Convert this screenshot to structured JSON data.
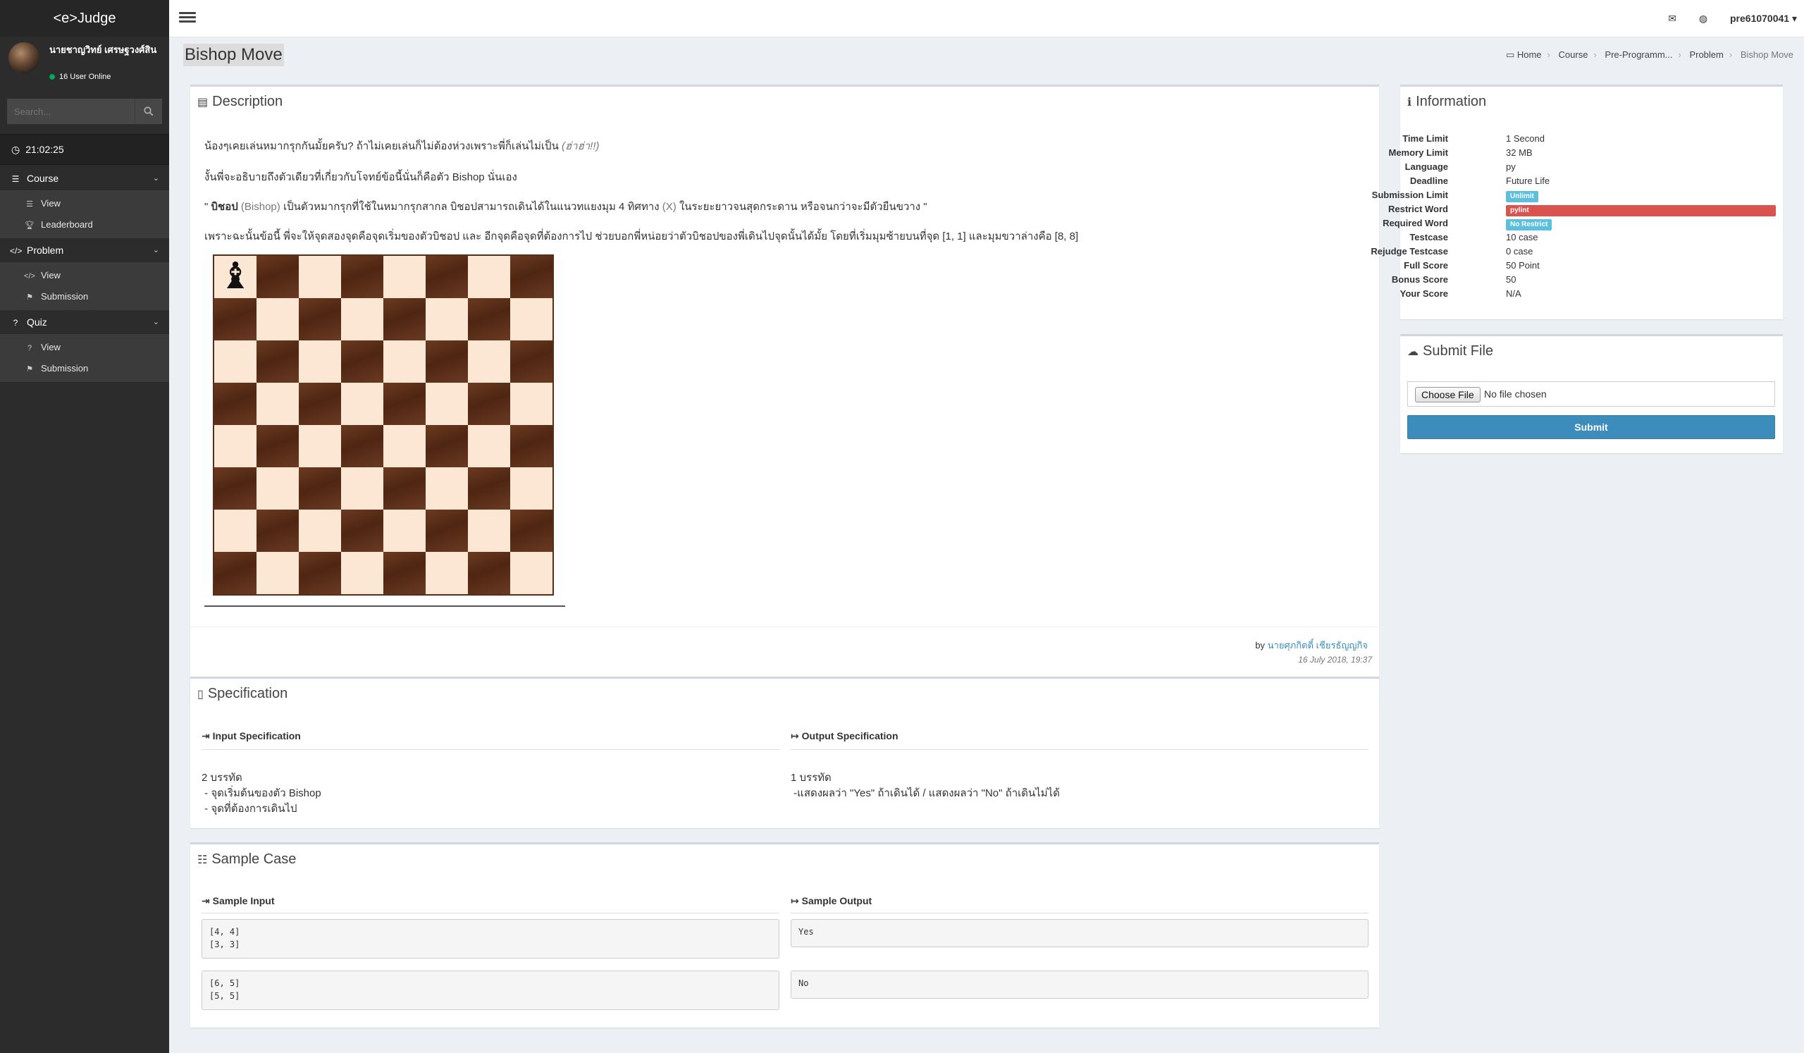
{
  "app": {
    "logo": "<e>Judge"
  },
  "user": {
    "name": "นายชาญวิทย์ เศรษฐวงศ์สิน",
    "online": "16 User Online"
  },
  "search": {
    "placeholder": "Search..."
  },
  "clock": {
    "time": "21:02:25"
  },
  "sidebar": {
    "course": {
      "label": "Course",
      "items": [
        "View",
        "Leaderboard"
      ]
    },
    "problem": {
      "label": "Problem",
      "items": [
        "View",
        "Submission"
      ]
    },
    "quiz": {
      "label": "Quiz",
      "items": [
        "View",
        "Submission"
      ]
    }
  },
  "navbar": {
    "username": "pre61070041"
  },
  "page": {
    "title": "Bishop Move"
  },
  "breadcrumb": [
    "Home",
    "Course",
    "Pre-Programm...",
    "Problem",
    "Bishop Move"
  ],
  "description": {
    "title": "Description",
    "p1": "น้องๆเคยเล่นหมากรุกกันมั้ยครับ? ถ้าไม่เคยเล่นก็ไม่ต้องห่วงเพราะพี่ก็เล่นไม่เป็น",
    "p1_note": "(ฮ่าฮ่า!!)",
    "p2": "งั้นพี่จะอธิบายถึงตัวเดียวที่เกี่ยวกับโจทย์ข้อนี้นั่นก็คือตัว Bishop นั่นเอง",
    "p3_open": "\"",
    "p3_bold": "บิชอป",
    "p3_paren": "(Bishop)",
    "p3_mid": "เป็นตัวหมากรุกที่ใช้ในหมากรุกสากล บิชอปสามารถเดินได้ในแนวทแยงมุม 4 ทิศทาง",
    "p3_x": "(X)",
    "p3_end": "ในระยะยาวจนสุดกระดาน หรือจนกว่าจะมีตัวยืนขวาง \"",
    "p4": "เพราะฉะนั้นข้อนี้ พี่จะให้จุดสองจุดคือจุดเริ่มของตัวบิชอป และ อีกจุดคือจุดที่ต้องการไป ช่วยบอกพี่หน่อยว่าตัวบิชอปของพี่เดินไปจุดนั้นได้มั้ย โดยที่เริ่มมุมซ้ายบนที่จุด [1, 1] และมุมขวาล่างคือ [8, 8]",
    "piece": "♝",
    "author_prefix": "by",
    "author": "นายศุภกิตติ์ เชียรธัญญกิจ",
    "posted": "16 July 2018, 19:37"
  },
  "specification": {
    "title": "Specification",
    "input_label": "Input Specification",
    "output_label": "Output Specification",
    "input_text": "2 บรรทัด\n - จุดเริ่มต้นของตัว Bishop\n - จุดที่ต้องการเดินไป",
    "output_text": "1 บรรทัด\n -แสดงผลว่า \"Yes\" ถ้าเดินได้ / แสดงผลว่า \"No\" ถ้าเดินไม่ได้"
  },
  "sample": {
    "title": "Sample Case",
    "input_label": "Sample Input",
    "output_label": "Sample Output",
    "cases": [
      {
        "input": "[4, 4]\n[3, 3]",
        "output": "Yes"
      },
      {
        "input": "[6, 5]\n[5, 5]",
        "output": "No"
      }
    ]
  },
  "information": {
    "title": "Information",
    "time_limit": {
      "label": "Time Limit",
      "value": "1 Second"
    },
    "memory_limit": {
      "label": "Memory Limit",
      "value": "32 MB"
    },
    "language": {
      "label": "Language",
      "value": "py"
    },
    "deadline": {
      "label": "Deadline",
      "value": "Future Life"
    },
    "submission_limit": {
      "label": "Submission Limit",
      "value": "Unlimit"
    },
    "restrict_word": {
      "label": "Restrict Word",
      "value": "pylint"
    },
    "required_word": {
      "label": "Required Word",
      "value": "No Restrict"
    },
    "testcase": {
      "label": "Testcase",
      "value": "10 case"
    },
    "rejudge": {
      "label": "Rejudge Testcase",
      "value": "0 case"
    },
    "full_score": {
      "label": "Full Score",
      "value": "50 Point"
    },
    "bonus_score": {
      "label": "Bonus Score",
      "value": "50"
    },
    "your_score": {
      "label": "Your Score",
      "value": "N/A"
    }
  },
  "submit": {
    "title": "Submit File",
    "choose_label": "Choose File",
    "no_file": "No file chosen",
    "button": "Submit"
  },
  "colors": {
    "primary": "#3c8dbc",
    "sidebar": "#2c2c2c",
    "badge_info": "#5bc0de",
    "badge_danger": "#d9534f"
  }
}
